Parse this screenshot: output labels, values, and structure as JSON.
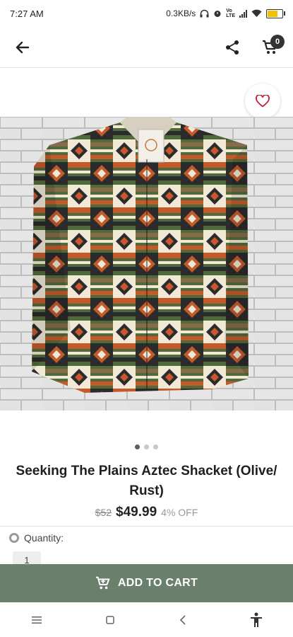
{
  "status_bar": {
    "time": "7:27 AM",
    "network_speed": "0.3KB/s",
    "battery_color": "#f2c200"
  },
  "app_bar": {
    "back_icon": "arrow-left-icon",
    "share_icon": "share-icon",
    "cart_icon": "shopping-cart-icon",
    "cart_count": "0"
  },
  "favorite": {
    "icon": "heart-outline-icon",
    "color": "#c2213a"
  },
  "gallery": {
    "image_count": 3,
    "active_index": 0
  },
  "product": {
    "title": "Seeking The Plains Aztec Shacket (Olive/ Rust)",
    "old_price": "$52",
    "price": "$49.99",
    "discount": "4% OFF"
  },
  "quantity": {
    "label": "Quantity:",
    "value": "1"
  },
  "add_to_cart": {
    "label": "ADD TO CART",
    "background": "#6b7f6d"
  },
  "nav_bar": {
    "menu_icon": "menu-icon",
    "home_icon": "square-icon",
    "back_icon": "chevron-left-icon",
    "accessibility_icon": "accessibility-icon"
  }
}
